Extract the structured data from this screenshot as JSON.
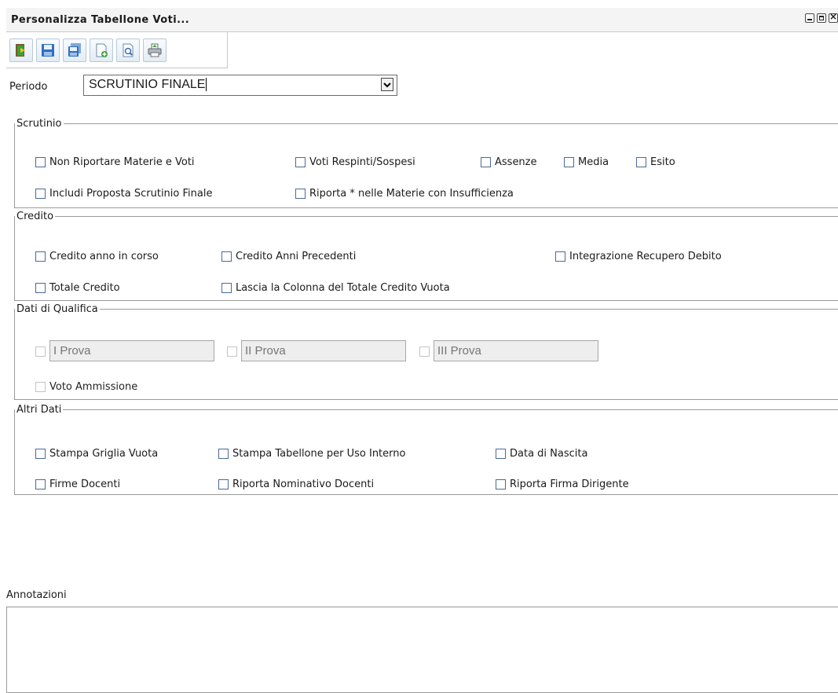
{
  "window": {
    "title": "Personalizza Tabellone Voti..."
  },
  "toolbar": {
    "buttons": [
      "exit-icon",
      "save-icon",
      "save-as-icon",
      "new-document-icon",
      "print-preview-icon",
      "print-icon"
    ]
  },
  "periodo": {
    "label": "Periodo",
    "value": "SCRUTINIO FINALE"
  },
  "scrutinio": {
    "legend": "Scrutinio",
    "options": [
      {
        "label": "Non Riportare Materie e Voti",
        "checked": false
      },
      {
        "label": "Voti Respinti/Sospesi",
        "checked": false
      },
      {
        "label": "Assenze",
        "checked": false
      },
      {
        "label": "Media",
        "checked": false
      },
      {
        "label": "Esito",
        "checked": false
      },
      {
        "label": "Includi Proposta Scrutinio Finale",
        "checked": false
      },
      {
        "label": "Riporta * nelle Materie con Insufficienza",
        "checked": false
      }
    ]
  },
  "credito": {
    "legend": "Credito",
    "options": [
      {
        "label": "Credito anno in corso",
        "checked": false
      },
      {
        "label": "Credito Anni Precedenti",
        "checked": false
      },
      {
        "label": "Integrazione Recupero Debito",
        "checked": false
      },
      {
        "label": "Totale Credito",
        "checked": false
      },
      {
        "label": "Lascia la Colonna del Totale Credito Vuota",
        "checked": false
      }
    ]
  },
  "qualifica": {
    "legend": "Dati di Qualifica",
    "prove": [
      {
        "placeholder": "I Prova",
        "enabled": false
      },
      {
        "placeholder": "II Prova",
        "enabled": false
      },
      {
        "placeholder": "III Prova",
        "enabled": false
      }
    ],
    "voto_ammissione": {
      "label": "Voto Ammissione",
      "enabled": false
    }
  },
  "altri": {
    "legend": "Altri Dati",
    "options": [
      {
        "label": "Stampa Griglia Vuota",
        "checked": false
      },
      {
        "label": "Stampa Tabellone per Uso Interno",
        "checked": false
      },
      {
        "label": "Data di Nascita",
        "checked": false
      },
      {
        "label": "Firme Docenti",
        "checked": false
      },
      {
        "label": "Riporta Nominativo Docenti",
        "checked": false
      },
      {
        "label": "Riporta Firma Dirigente",
        "checked": false
      }
    ]
  },
  "annotazioni": {
    "label": "Annotazioni",
    "value": ""
  }
}
